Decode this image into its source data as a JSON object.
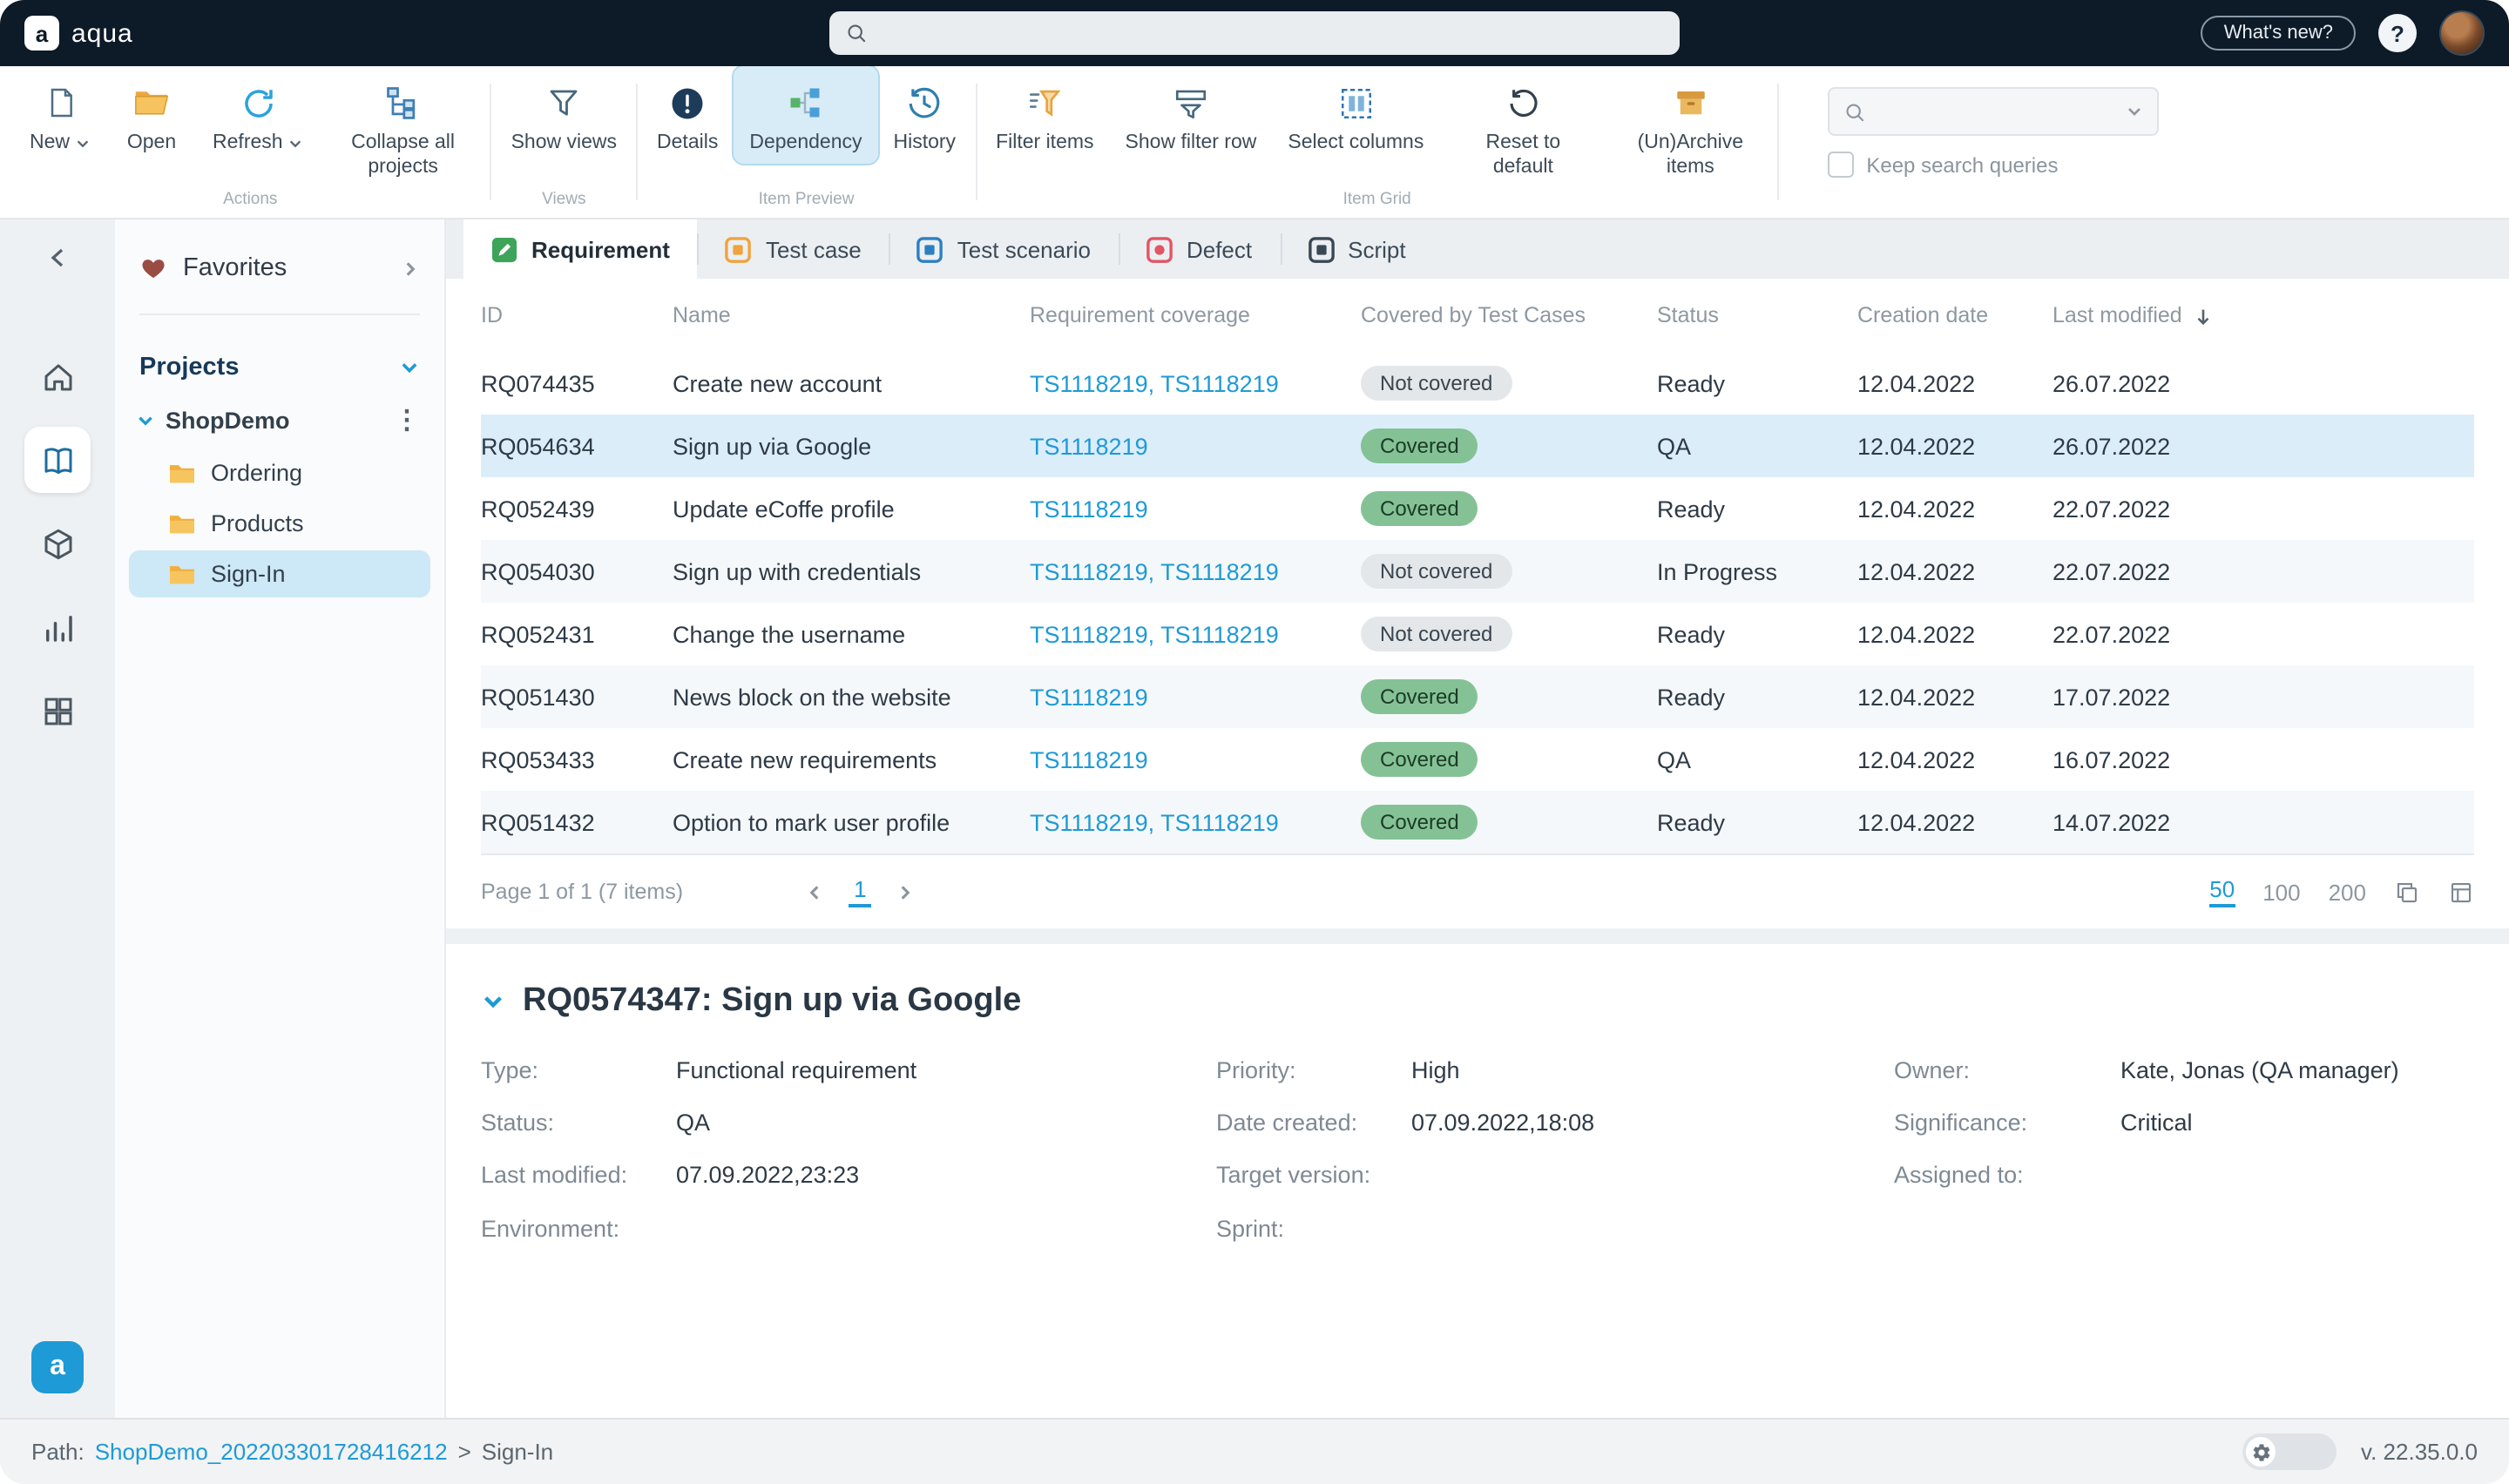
{
  "colors": {
    "accent_blue": "#1e9ad6",
    "topbar_bg": "#0d1a28",
    "covered_green": "#84c295",
    "not_covered_gray": "#e4e7e9",
    "selected_row_blue": "#dbedf9",
    "tab_requirement_green": "#3ea45a",
    "tab_test_case_orange": "#f0a33d",
    "tab_test_scenario_blue": "#2d7fc1",
    "tab_defect_red": "#e25563",
    "tab_script_dark": "#3a4754"
  },
  "topbar": {
    "brand": "aqua",
    "brand_mark": "a",
    "whats_new_label": "What's new?",
    "help_label": "?"
  },
  "toolbar": {
    "actions": {
      "caption": "Actions",
      "new_label": "New",
      "open_label": "Open",
      "refresh_label": "Refresh",
      "collapse_label": "Collapse all projects"
    },
    "views": {
      "caption": "Views",
      "show_views_label": "Show views"
    },
    "item_preview": {
      "caption": "Item Preview",
      "details_label": "Details",
      "dependency_label": "Dependency",
      "history_label": "History"
    },
    "item_grid": {
      "caption": "Item Grid",
      "filter_items_label": "Filter items",
      "show_filter_row_label": "Show filter row",
      "select_columns_label": "Select columns",
      "reset_label": "Reset to default",
      "archive_label": "(Un)Archive items"
    },
    "search": {
      "keep_queries_label": "Keep search queries"
    }
  },
  "sidebar": {
    "favorites_label": "Favorites",
    "projects_label": "Projects",
    "project_name": "ShopDemo",
    "folders": [
      {
        "label": "Ordering",
        "selected": false
      },
      {
        "label": "Products",
        "selected": false
      },
      {
        "label": "Sign-In",
        "selected": true
      }
    ]
  },
  "tabs": [
    {
      "label": "Requirement",
      "active": true
    },
    {
      "label": "Test case",
      "active": false
    },
    {
      "label": "Test scenario",
      "active": false
    },
    {
      "label": "Defect",
      "active": false
    },
    {
      "label": "Script",
      "active": false
    }
  ],
  "table": {
    "columns": [
      "ID",
      "Name",
      "Requirement coverage",
      "Covered by Test Cases",
      "Status",
      "Creation date",
      "Last modified"
    ],
    "sorted_by": "Last modified",
    "rows": [
      {
        "id": "RQ074435",
        "name": "Create new account",
        "coverage": "TS1118219, TS1118219",
        "covered": "Not covered",
        "is_covered": false,
        "status": "Ready",
        "created": "12.04.2022",
        "modified": "26.07.2022",
        "selected": false
      },
      {
        "id": "RQ054634",
        "name": "Sign up via Google",
        "coverage": "TS1118219",
        "covered": "Covered",
        "is_covered": true,
        "status": "QA",
        "created": "12.04.2022",
        "modified": "26.07.2022",
        "selected": true
      },
      {
        "id": "RQ052439",
        "name": "Update eCoffe profile",
        "coverage": "TS1118219",
        "covered": "Covered",
        "is_covered": true,
        "status": "Ready",
        "created": "12.04.2022",
        "modified": "22.07.2022",
        "selected": false
      },
      {
        "id": "RQ054030",
        "name": "Sign up with credentials",
        "coverage": "TS1118219, TS1118219",
        "covered": "Not covered",
        "is_covered": false,
        "status": "In Progress",
        "created": "12.04.2022",
        "modified": "22.07.2022",
        "selected": false
      },
      {
        "id": "RQ052431",
        "name": "Change the username",
        "coverage": "TS1118219, TS1118219",
        "covered": "Not covered",
        "is_covered": false,
        "status": "Ready",
        "created": "12.04.2022",
        "modified": "22.07.2022",
        "selected": false
      },
      {
        "id": "RQ051430",
        "name": "News block on the website",
        "coverage": "TS1118219",
        "covered": "Covered",
        "is_covered": true,
        "status": "Ready",
        "created": "12.04.2022",
        "modified": "17.07.2022",
        "selected": false
      },
      {
        "id": "RQ053433",
        "name": "Create new requirements",
        "coverage": "TS1118219",
        "covered": "Covered",
        "is_covered": true,
        "status": "QA",
        "created": "12.04.2022",
        "modified": "16.07.2022",
        "selected": false
      },
      {
        "id": "RQ051432",
        "name": "Option to mark user profile",
        "coverage": "TS1118219, TS1118219",
        "covered": "Covered",
        "is_covered": true,
        "status": "Ready",
        "created": "12.04.2022",
        "modified": "14.07.2022",
        "selected": false
      }
    ],
    "pagination": {
      "summary": "Page 1 of 1 (7 items)",
      "current_page": "1",
      "sizes": [
        "50",
        "100",
        "200"
      ],
      "active_size": "50"
    }
  },
  "detail": {
    "title": "RQ0574347: Sign up via Google",
    "col1": [
      {
        "label": "Type:",
        "value": "Functional requirement"
      },
      {
        "label": "Status:",
        "value": "QA"
      },
      {
        "label": "Last modified:",
        "value": "07.09.2022,23:23"
      },
      {
        "label": "Environment:",
        "value": ""
      }
    ],
    "col2": [
      {
        "label": "Priority:",
        "value": "High"
      },
      {
        "label": "Date created:",
        "value": "07.09.2022,18:08"
      },
      {
        "label": "Target version:",
        "value": ""
      },
      {
        "label": "Sprint:",
        "value": ""
      }
    ],
    "col3": [
      {
        "label": "Owner:",
        "value": "Kate, Jonas (QA manager)"
      },
      {
        "label": "Significance:",
        "value": "Critical"
      },
      {
        "label": "Assigned to:",
        "value": ""
      }
    ]
  },
  "statusbar": {
    "path_label": "Path:",
    "path_project": "ShopDemo_202203301728416212",
    "path_separator": ">",
    "path_item": "Sign-In",
    "version": "v. 22.35.0.0"
  }
}
